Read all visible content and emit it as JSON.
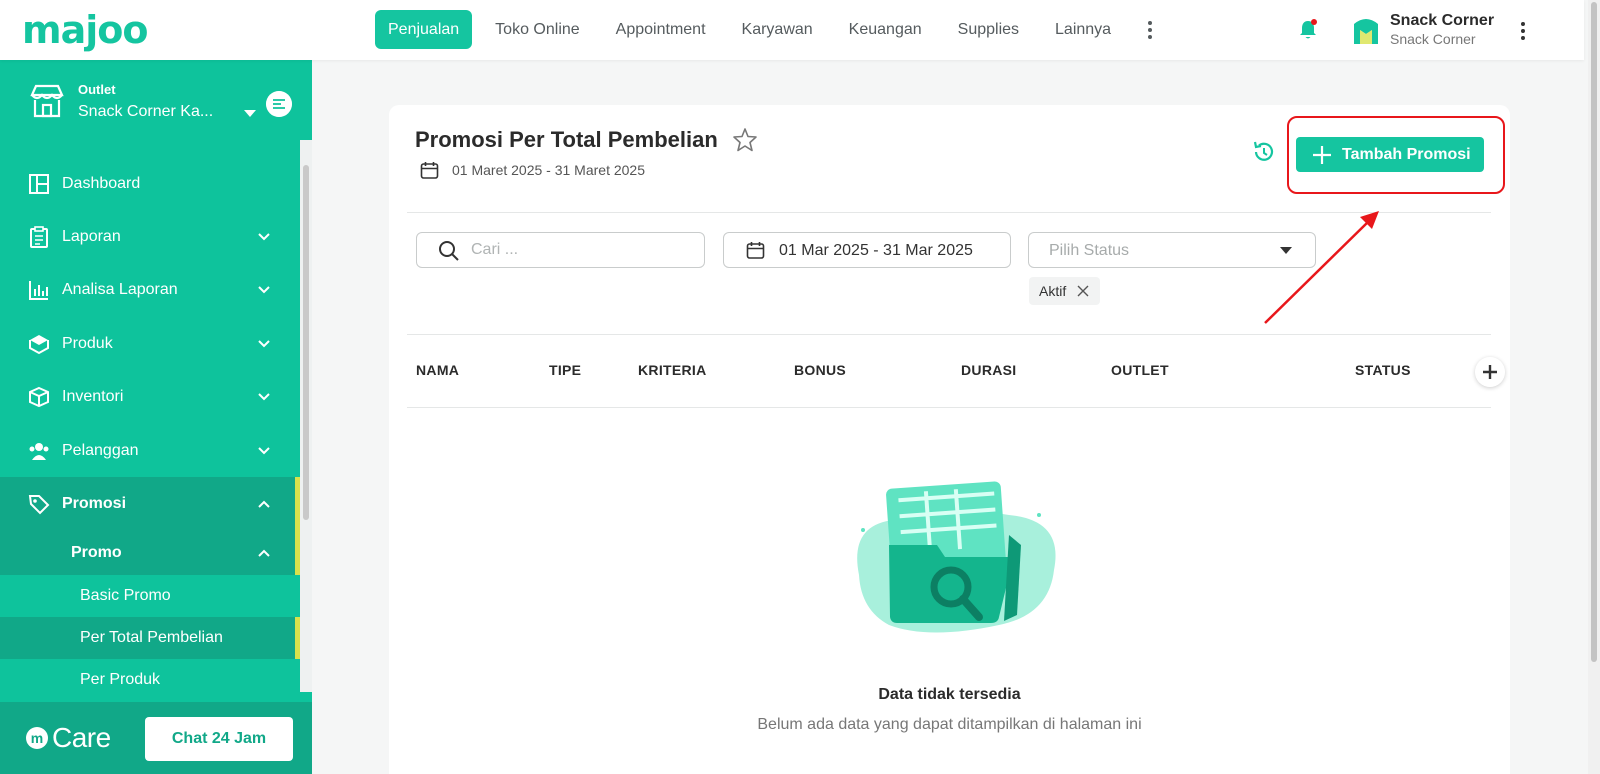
{
  "brand": {
    "logo_text": "majoo",
    "accent": "#15c5a0",
    "sidebar_bg": "#0ec39c",
    "highlight": "#e8171b"
  },
  "topnav": {
    "items": [
      {
        "label": "Penjualan",
        "active": true
      },
      {
        "label": "Toko Online"
      },
      {
        "label": "Appointment"
      },
      {
        "label": "Karyawan"
      },
      {
        "label": "Keuangan"
      },
      {
        "label": "Supplies"
      },
      {
        "label": "Lainnya"
      }
    ],
    "more_icon": "kebab-icon",
    "notification_icon": "bell-icon"
  },
  "user": {
    "name": "Snack Corner",
    "store": "Snack Corner"
  },
  "sidebar": {
    "outlet_label": "Outlet",
    "outlet_name": "Snack Corner Ka...",
    "menu": [
      {
        "label": "Dashboard",
        "icon": "dashboard-icon"
      },
      {
        "label": "Laporan",
        "icon": "clipboard-icon"
      },
      {
        "label": "Analisa Laporan",
        "icon": "bar-chart-icon"
      },
      {
        "label": "Produk",
        "icon": "box-icon"
      },
      {
        "label": "Inventori",
        "icon": "inventory-icon"
      },
      {
        "label": "Pelanggan",
        "icon": "users-icon"
      },
      {
        "label": "Promosi",
        "icon": "tag-icon"
      }
    ],
    "submenu_label": "Promo",
    "leaves": [
      "Basic Promo",
      "Per Total Pembelian",
      "Per Produk"
    ],
    "footer": {
      "care_text": "Care",
      "chat_label": "Chat 24 Jam"
    }
  },
  "page": {
    "title": "Promosi Per Total Pembelian",
    "date_range": "01 Maret 2025 - 31 Maret 2025",
    "add_button": "Tambah Promosi",
    "search_placeholder": "Cari ...",
    "date_filter": "01 Mar 2025 - 31 Mar 2025",
    "status_placeholder": "Pilih Status",
    "active_chip": "Aktif",
    "columns": [
      "NAMA",
      "TIPE",
      "KRITERIA",
      "BONUS",
      "DURASI",
      "OUTLET",
      "STATUS"
    ],
    "empty_title": "Data tidak tersedia",
    "empty_subtitle": "Belum ada data yang dapat ditampilkan di halaman ini"
  }
}
